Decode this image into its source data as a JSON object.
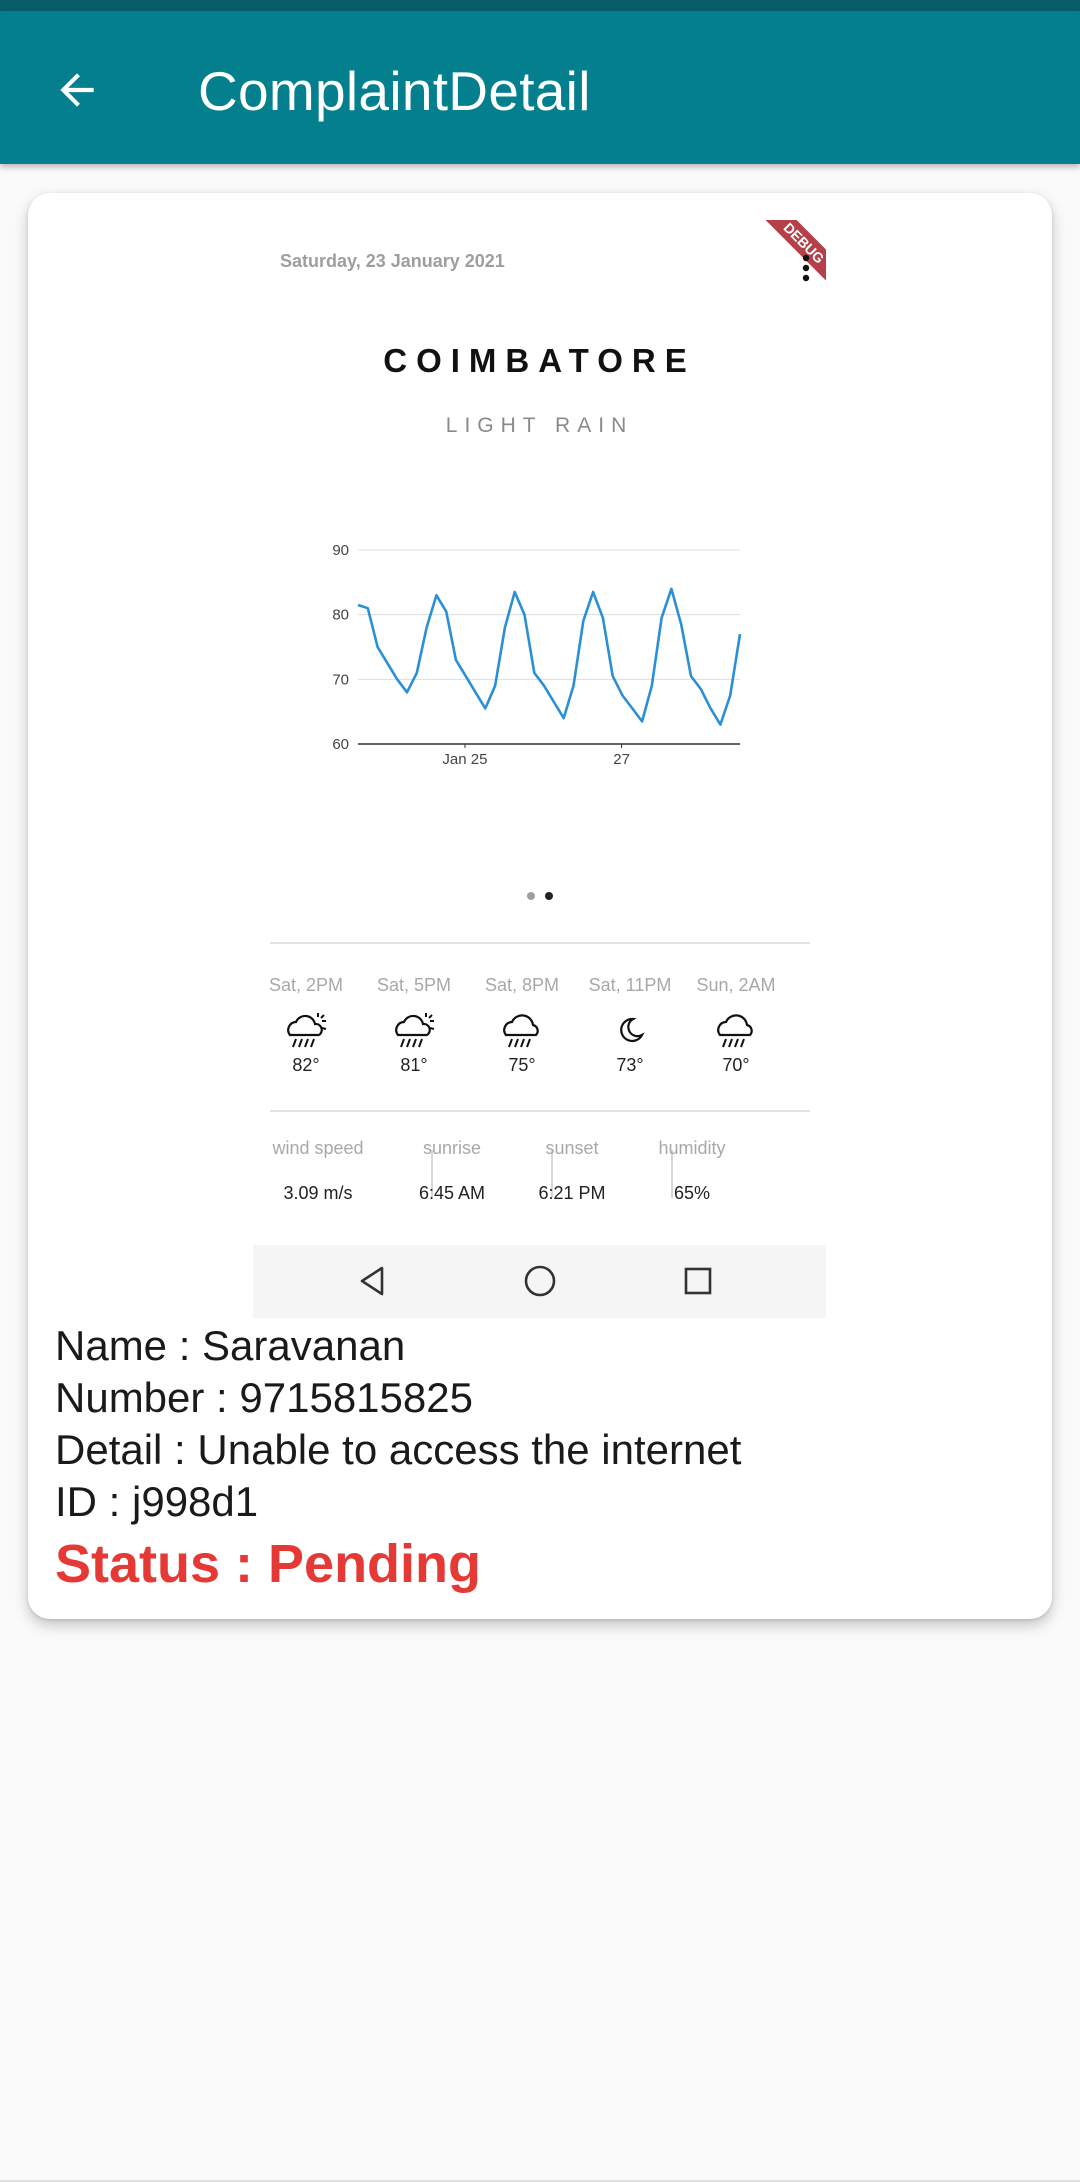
{
  "appbar": {
    "title": "ComplaintDetail"
  },
  "weather": {
    "date": "Saturday, 23 January 2021",
    "debug_banner": "DEBUG",
    "city": "COIMBATORE",
    "condition": "LIGHT RAIN",
    "accent_color": "#2b8fd6",
    "forecast": [
      {
        "time": "Sat, 2PM",
        "icon": "rain-sun-icon",
        "temp": "82°"
      },
      {
        "time": "Sat, 5PM",
        "icon": "rain-sun-icon",
        "temp": "81°"
      },
      {
        "time": "Sat, 8PM",
        "icon": "rain-cloud-icon",
        "temp": "75°"
      },
      {
        "time": "Sat, 11PM",
        "icon": "moon-icon",
        "temp": "73°"
      },
      {
        "time": "Sun, 2AM",
        "icon": "rain-cloud-icon",
        "temp": "70°"
      }
    ],
    "stats": [
      {
        "label": "wind speed",
        "value": "3.09 m/s"
      },
      {
        "label": "sunrise",
        "value": "6:45 AM"
      },
      {
        "label": "sunset",
        "value": "6:21 PM"
      },
      {
        "label": "humidity",
        "value": "65%"
      }
    ],
    "pager": {
      "count": 2,
      "active": 1
    }
  },
  "chart_data": {
    "type": "line",
    "title": "",
    "xlabel": "",
    "ylabel": "",
    "ylim": [
      60,
      90
    ],
    "yticks": [
      60,
      70,
      80,
      90
    ],
    "xticks": [
      "Jan 25",
      "27"
    ],
    "grid": true,
    "series": [
      {
        "values": [
          81.5,
          81,
          75,
          72.5,
          70,
          68,
          71,
          78,
          83,
          80.5,
          73,
          70.5,
          68,
          65.5,
          69,
          78,
          83.5,
          80,
          71,
          69,
          66.5,
          64,
          69,
          79,
          83.5,
          79.5,
          70.5,
          67.5,
          65.5,
          63.5,
          69,
          79.5,
          84,
          78.5,
          70.5,
          68.5,
          65.5,
          63,
          67.5,
          77
        ]
      }
    ]
  },
  "complaint": {
    "name": "Name : Saravanan",
    "number": "Number : 9715815825",
    "detail": "Detail : Unable to access the internet",
    "id": "ID :  j998d1",
    "status": "Status : Pending",
    "status_color": "#e53935"
  }
}
